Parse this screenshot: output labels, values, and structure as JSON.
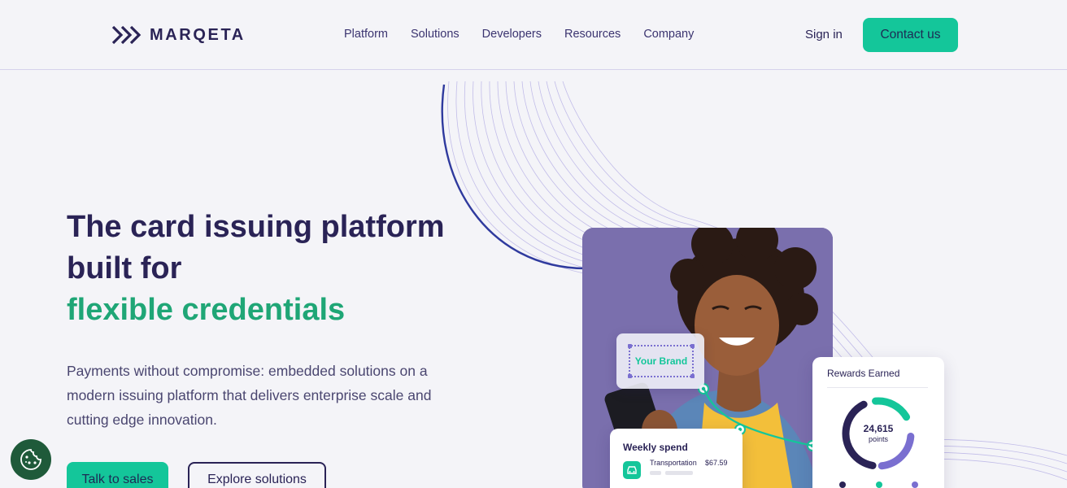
{
  "header": {
    "logo_text": "MARQETA",
    "nav": [
      "Platform",
      "Solutions",
      "Developers",
      "Resources",
      "Company"
    ],
    "sign_in": "Sign in",
    "contact": "Contact us"
  },
  "hero": {
    "headline_line1": "The card issuing platform",
    "headline_line2": "built for",
    "headline_accent": "flexible credentials",
    "subtext": "Payments without compromise: embedded solutions on a modern issuing platform that delivers enterprise scale and cutting edge innovation.",
    "primary_cta": "Talk to sales",
    "secondary_cta": "Explore solutions"
  },
  "illustration": {
    "brand_card_label": "Your Brand",
    "weekly_spend": {
      "title": "Weekly spend",
      "item_label": "Transportation",
      "item_amount": "$67.59"
    },
    "rewards": {
      "title": "Rewards Earned",
      "points_value": "24,615",
      "points_label": "points"
    }
  },
  "colors": {
    "brand_navy": "#2a2356",
    "accent_green": "#14c69a",
    "headline_green": "#1fa676",
    "purple": "#7b6fae"
  },
  "icons": [
    "marqeta-logo-icon",
    "cookie-icon",
    "car-icon"
  ]
}
